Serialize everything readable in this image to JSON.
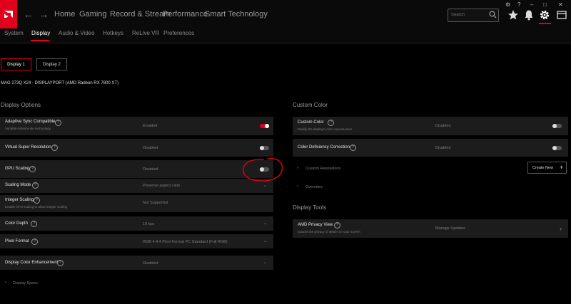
{
  "topnav": {
    "items": [
      {
        "label": "Home"
      },
      {
        "label": "Gaming"
      },
      {
        "label": "Record & Stream"
      },
      {
        "label": "Performance"
      },
      {
        "label": "Smart Technology"
      }
    ],
    "search_placeholder": "Search"
  },
  "subnav": {
    "tabs": [
      {
        "label": "System"
      },
      {
        "label": "Display"
      },
      {
        "label": "Audio & Video"
      },
      {
        "label": "Hotkeys"
      },
      {
        "label": "ReLive VR"
      },
      {
        "label": "Preferences"
      }
    ],
    "active": "Display"
  },
  "display_buttons": [
    {
      "label": "Display 1"
    },
    {
      "label": "Display 2"
    }
  ],
  "active_display": "Display 1",
  "monitor_info": "MAG 273Q X24 - DISPLAYPORT (AMD Radeon RX 7800 XT)",
  "display_options": {
    "title": "Display Options",
    "rows": [
      {
        "label": "Adaptive Sync Compatible",
        "sub": "Variable-refresh-rate technology",
        "value": "Enabled",
        "toggle": "on"
      },
      {
        "label": "Virtual Super Resolution",
        "value": "Disabled",
        "toggle": "off"
      },
      {
        "label": "GPU Scaling",
        "value": "Disabled",
        "toggle": "off"
      },
      {
        "label": "Scaling Mode",
        "value": "Preserve aspect ratio",
        "dropdown": true
      },
      {
        "label": "Integer Scaling",
        "sub": "Enable GPU scaling to allow integer scaling",
        "value": "Not Supported"
      },
      {
        "label": "Color Depth",
        "value": "10 bpc",
        "dropdown": true
      },
      {
        "label": "Pixel Format",
        "value": "RGB 4:4:4 Pixel Format PC Standard (Full RGB)",
        "dropdown": true
      },
      {
        "label": "Display Color Enhancement",
        "value": "Disabled",
        "dropdown": true
      }
    ],
    "display_specs": "Display Specs"
  },
  "custom_color": {
    "title": "Custom Color",
    "rows": [
      {
        "label": "Custom Color",
        "sub": "Modify the display's color reproduction",
        "value": "Disabled",
        "toggle": "off"
      },
      {
        "label": "Color Deficiency Correction",
        "value": "Disabled",
        "toggle": "off"
      }
    ],
    "custom_resolutions": "Custom Resolutions",
    "create_new": "Create New",
    "overrides": "Overrides"
  },
  "display_tools": {
    "title": "Display Tools",
    "row": {
      "label": "AMD Privacy View",
      "sub": "Guards the privacy of what's on your screen",
      "value": "Manage Updates"
    }
  },
  "colors": {
    "accent": "#e0001b",
    "row_bg": "#1c1c1c",
    "background": "#000000",
    "annotation": "#e0001b"
  }
}
